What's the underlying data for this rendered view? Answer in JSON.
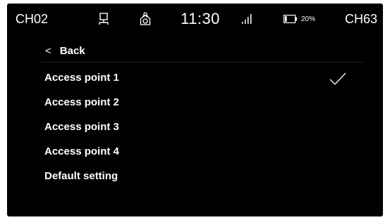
{
  "status_bar": {
    "channel_left": "CH02",
    "network_icon": "network-lan-icon",
    "ap_icon": "access-point-icon",
    "time": "11:30",
    "signal_icon": "signal-bars-icon",
    "battery_icon": "battery-icon",
    "battery_percent": "20%",
    "battery_level": 0.2,
    "channel_right": "CH63"
  },
  "navigation": {
    "back_chevron": "<",
    "back_label": "Back"
  },
  "menu": {
    "items": [
      {
        "label": "Access point 1",
        "selected": true
      },
      {
        "label": "Access point 2",
        "selected": false
      },
      {
        "label": "Access point 3",
        "selected": false
      },
      {
        "label": "Access point 4",
        "selected": false
      },
      {
        "label": "Default setting",
        "selected": false
      }
    ],
    "selected_icon": "check-icon"
  },
  "colors": {
    "background": "#000000",
    "text": "#ffffff",
    "divider": "#1c1c1c"
  }
}
